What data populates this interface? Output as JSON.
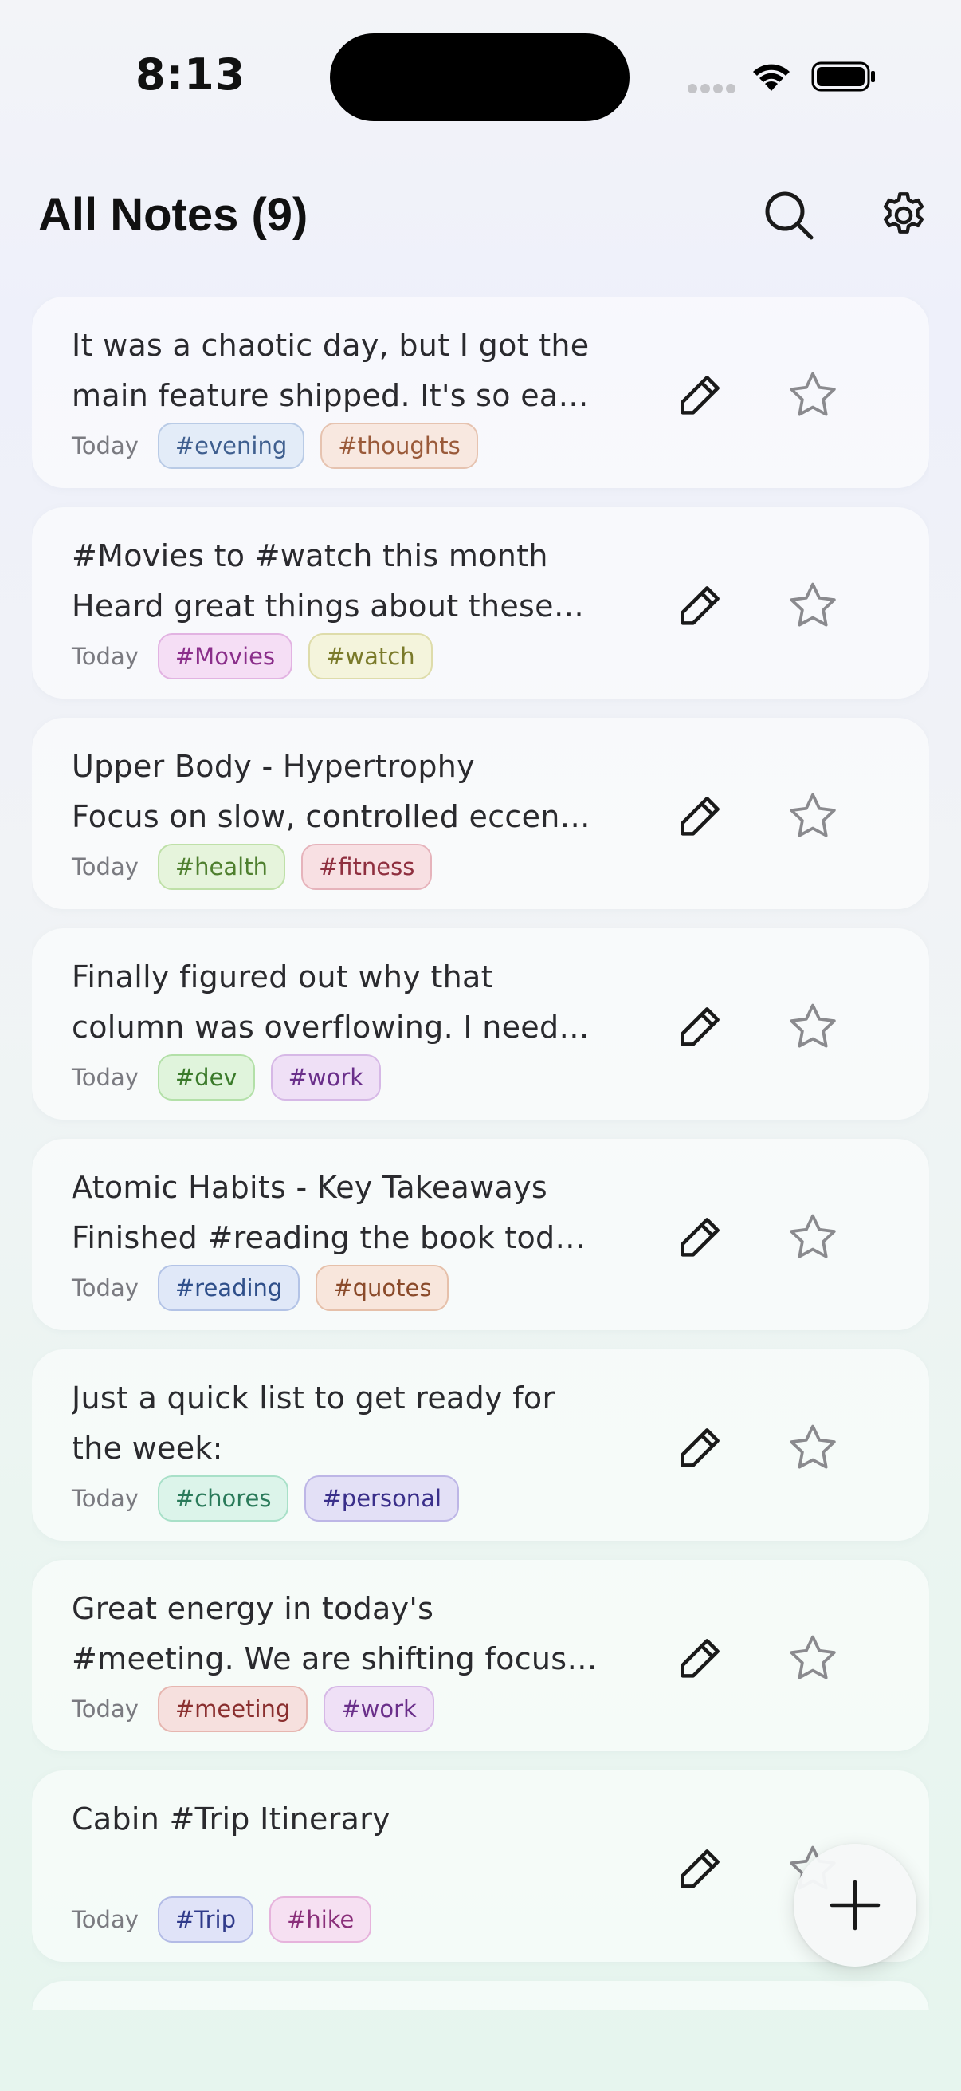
{
  "status_bar": {
    "time": "8:13"
  },
  "header": {
    "title": "All Notes (9)",
    "search_icon": "search-icon",
    "settings_icon": "gear-icon"
  },
  "colors": {
    "tag_evening": "#3f5f8f",
    "tag_thoughts": "#9a5a3a",
    "tag_movies": "#8a2e8a",
    "tag_watch": "#7a7a2a",
    "tag_health": "#4f7f2f",
    "tag_fitness": "#8f2f3f",
    "tag_dev": "#3a7a2a",
    "tag_work": "#6a2f8a",
    "tag_reading": "#2f4f8a",
    "tag_quotes": "#8a4a2a",
    "tag_chores": "#2a7a5a",
    "tag_personal": "#3a2f8a",
    "tag_meeting": "#8a2f2f",
    "tag_trip": "#2f3a8a",
    "tag_hike": "#8a2f7a"
  },
  "notes": [
    {
      "line1": "It was a chaotic day, but I got the",
      "line2": "main feature shipped. It's so ea…",
      "date": "Today",
      "tags": [
        {
          "label": "#evening",
          "color": "#3f5f8f",
          "bg": "#e3ecf8",
          "border": "#b9cbe6"
        },
        {
          "label": "#thoughts",
          "color": "#9a5a3a",
          "bg": "#f8e8e0",
          "border": "#e6c3b0"
        }
      ]
    },
    {
      "line1": "#Movies to #watch this month",
      "line2": "Heard great things about these…",
      "date": "Today",
      "tags": [
        {
          "label": "#Movies",
          "color": "#8a2e8a",
          "bg": "#f5def5",
          "border": "#e2b3e2"
        },
        {
          "label": "#watch",
          "color": "#7a7a2a",
          "bg": "#f4f4dc",
          "border": "#dedcaa"
        }
      ]
    },
    {
      "line1": "Upper Body - Hypertrophy",
      "line2": "Focus on slow, controlled eccen…",
      "date": "Today",
      "tags": [
        {
          "label": "#health",
          "color": "#4f7f2f",
          "bg": "#e6f4dc",
          "border": "#bfe0a8"
        },
        {
          "label": "#fitness",
          "color": "#8f2f3f",
          "bg": "#f8e0e3",
          "border": "#e6b3bb"
        }
      ]
    },
    {
      "line1": "Finally figured out why that",
      "line2": "column was overflowing. I need…",
      "date": "Today",
      "tags": [
        {
          "label": "#dev",
          "color": "#3a7a2a",
          "bg": "#e0f4dc",
          "border": "#b3e0a8"
        },
        {
          "label": "#work",
          "color": "#6a2f8a",
          "bg": "#efe0f6",
          "border": "#d6b8e6"
        }
      ]
    },
    {
      "line1": "Atomic Habits - Key Takeaways",
      "line2": "Finished #reading the book tod…",
      "date": "Today",
      "tags": [
        {
          "label": "#reading",
          "color": "#2f4f8a",
          "bg": "#e0e8f8",
          "border": "#b3c3e6"
        },
        {
          "label": "#quotes",
          "color": "#8a4a2a",
          "bg": "#f8e6dc",
          "border": "#e6c0aa"
        }
      ]
    },
    {
      "line1": "Just a quick list to get ready for",
      "line2": "the week:",
      "date": "Today",
      "tags": [
        {
          "label": "#chores",
          "color": "#2a7a5a",
          "bg": "#dcf4ea",
          "border": "#a8e0c8"
        },
        {
          "label": "#personal",
          "color": "#3a2f8a",
          "bg": "#e3e0f6",
          "border": "#bdb6e6"
        }
      ]
    },
    {
      "line1": "Great energy in today's",
      "line2": "#meeting. We are shifting focus…",
      "date": "Today",
      "tags": [
        {
          "label": "#meeting",
          "color": "#8a2f2f",
          "bg": "#f6e0de",
          "border": "#e6b6b0"
        },
        {
          "label": "#work",
          "color": "#6a2f8a",
          "bg": "#efe0f6",
          "border": "#d6b8e6"
        }
      ]
    },
    {
      "line1": "Cabin #Trip Itinerary",
      "line2": "",
      "date": "Today",
      "tags": [
        {
          "label": "#Trip",
          "color": "#2f3a8a",
          "bg": "#e0e3f8",
          "border": "#b3bbe6"
        },
        {
          "label": "#hike",
          "color": "#8a2f7a",
          "bg": "#f6e0f2",
          "border": "#e6b3dc"
        }
      ]
    }
  ],
  "fab": {
    "icon": "plus-icon"
  }
}
